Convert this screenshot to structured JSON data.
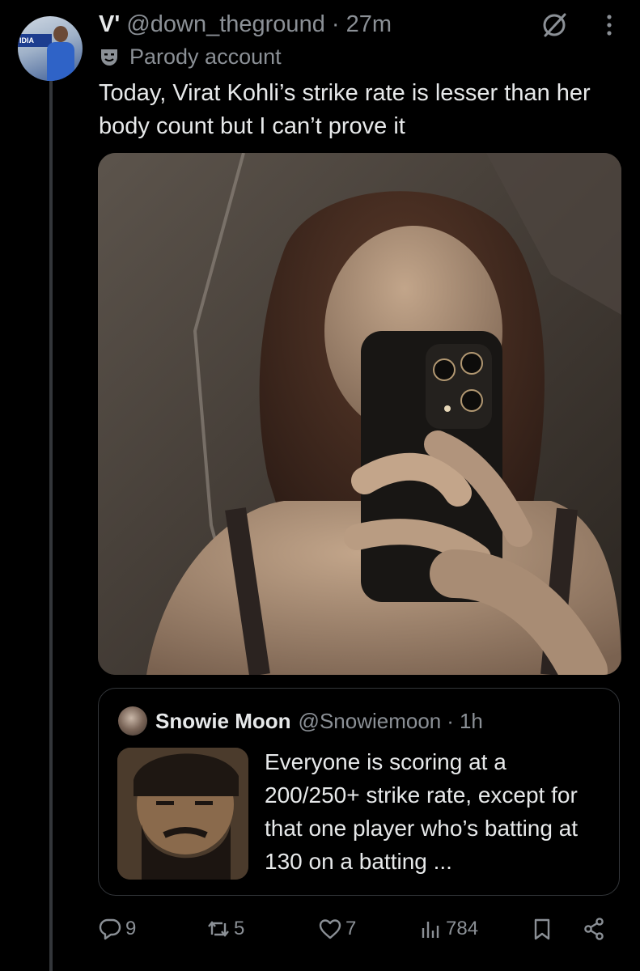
{
  "tweet": {
    "display_name": "V'",
    "handle": "@down_theground",
    "separator": "·",
    "time": "27m",
    "parody_label": "Parody account",
    "text": "Today, Virat Kohli’s strike rate is lesser than her body count but I can’t prove it",
    "avatar_banner_text": "IDIA"
  },
  "quoted_tweet": {
    "display_name": "Snowie Moon",
    "handle": "@Snowiemoon",
    "separator": "·",
    "time": "1h",
    "text": "Everyone is scoring at a 200/250+ strike rate, except for that one player who’s batting at 130 on a batting ..."
  },
  "actions": {
    "replies": "9",
    "reposts": "5",
    "likes": "7",
    "views": "784"
  },
  "colors": {
    "background": "#000000",
    "text_primary": "#e7e9ea",
    "text_secondary": "#8b9096",
    "border": "#33363a"
  },
  "icons": {
    "grok": "grok-icon",
    "more": "more-vertical-icon",
    "parody": "parody-mask-icon",
    "reply": "reply-icon",
    "repost": "repost-icon",
    "like": "heart-icon",
    "views": "views-chart-icon",
    "bookmark": "bookmark-icon",
    "share": "share-icon"
  }
}
